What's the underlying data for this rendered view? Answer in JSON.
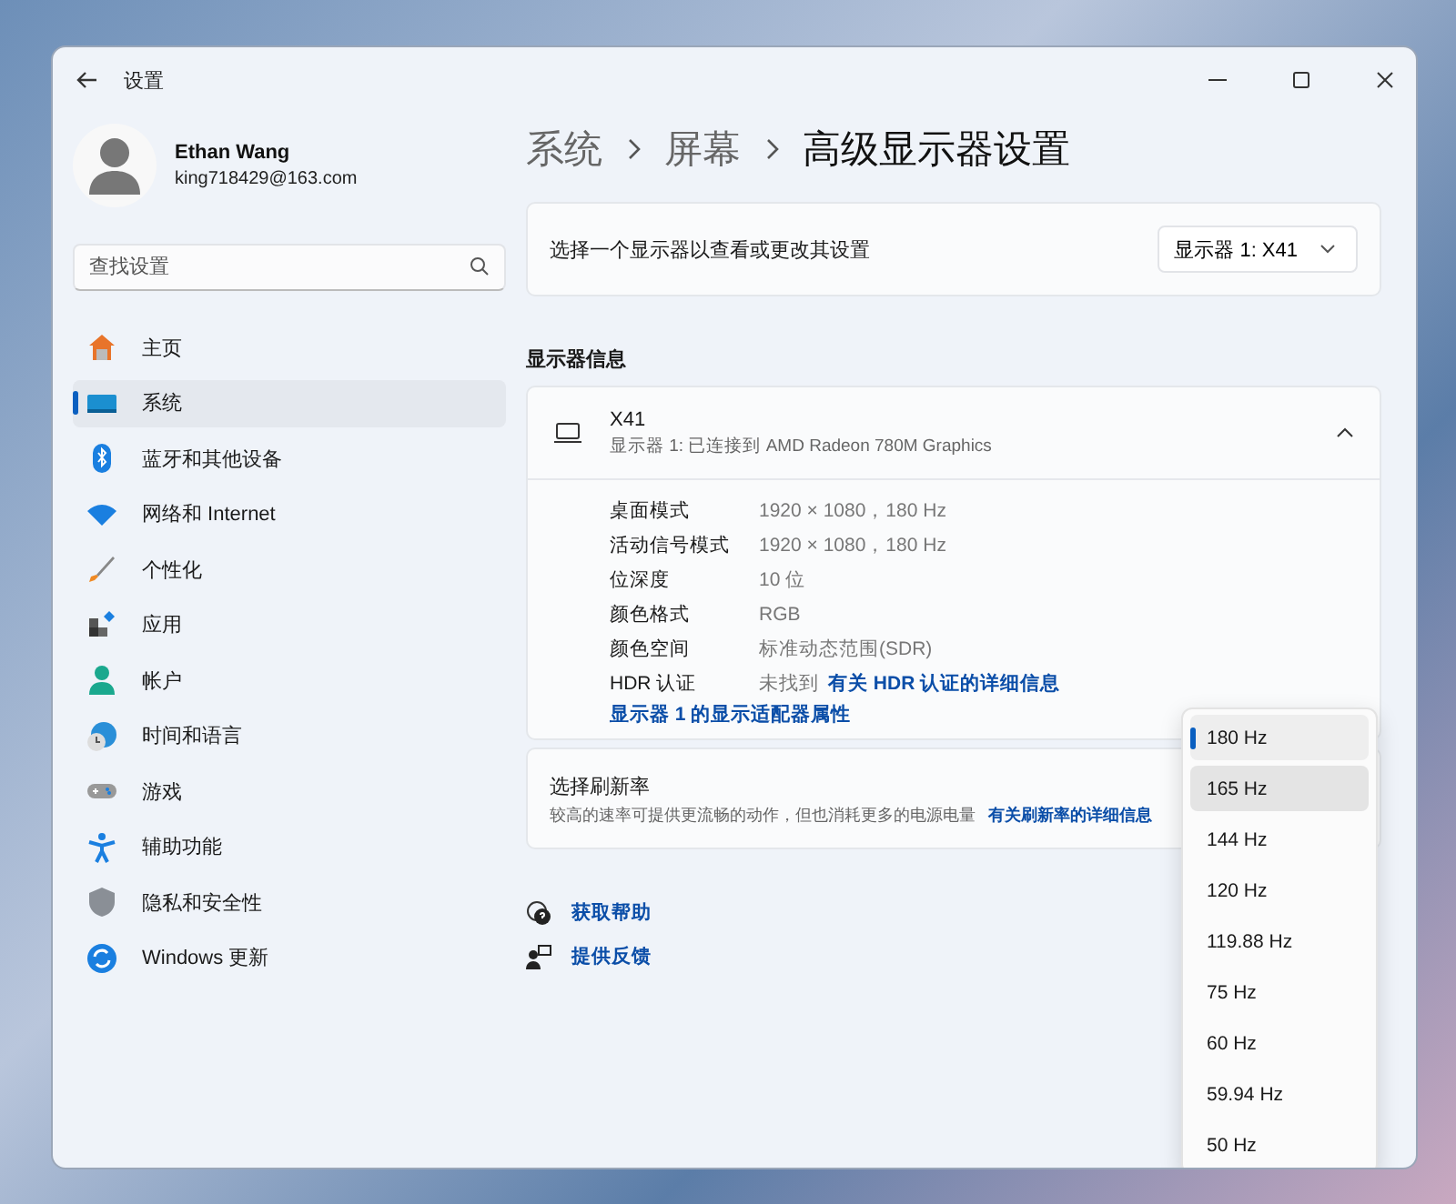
{
  "window": {
    "title": "设置"
  },
  "account": {
    "name": "Ethan Wang",
    "email": "king718429@163.com"
  },
  "search": {
    "placeholder": "查找设置"
  },
  "sidebar": {
    "items": [
      {
        "label": "主页",
        "selected": false
      },
      {
        "label": "系统",
        "selected": true
      },
      {
        "label": "蓝牙和其他设备",
        "selected": false
      },
      {
        "label": "网络和 Internet",
        "selected": false
      },
      {
        "label": "个性化",
        "selected": false
      },
      {
        "label": "应用",
        "selected": false
      },
      {
        "label": "帐户",
        "selected": false
      },
      {
        "label": "时间和语言",
        "selected": false
      },
      {
        "label": "游戏",
        "selected": false
      },
      {
        "label": "辅助功能",
        "selected": false
      },
      {
        "label": "隐私和安全性",
        "selected": false
      },
      {
        "label": "Windows 更新",
        "selected": false
      }
    ]
  },
  "breadcrumb": [
    "系统",
    "屏幕",
    "高级显示器设置"
  ],
  "display_select": {
    "label": "选择一个显示器以查看或更改其设置",
    "value": "显示器 1: X41"
  },
  "section_title": "显示器信息",
  "display_card": {
    "name": "X41",
    "subtitle": "显示器 1: 已连接到 AMD Radeon 780M Graphics",
    "expanded": true,
    "rows": [
      {
        "label": "桌面模式",
        "value": "1920 × 1080，180 Hz"
      },
      {
        "label": "活动信号模式",
        "value": "1920 × 1080，180 Hz"
      },
      {
        "label": "位深度",
        "value": "10 位"
      },
      {
        "label": "颜色格式",
        "value": "RGB"
      },
      {
        "label": "颜色空间",
        "value": "标准动态范围(SDR)"
      },
      {
        "label": "HDR 认证",
        "value": "未找到",
        "link": "有关 HDR 认证的详细信息"
      }
    ],
    "adapter_link": "显示器 1 的显示适配器属性"
  },
  "refresh_rate": {
    "title": "选择刷新率",
    "description": "较高的速率可提供更流畅的动作，但也消耗更多的电源电量",
    "link": "有关刷新率的详细信息",
    "options": [
      {
        "label": "180 Hz",
        "selected": true,
        "hovered": false
      },
      {
        "label": "165 Hz",
        "selected": false,
        "hovered": true
      },
      {
        "label": "144 Hz",
        "selected": false,
        "hovered": false
      },
      {
        "label": "120 Hz",
        "selected": false,
        "hovered": false
      },
      {
        "label": "119.88 Hz",
        "selected": false,
        "hovered": false
      },
      {
        "label": "75 Hz",
        "selected": false,
        "hovered": false
      },
      {
        "label": "60 Hz",
        "selected": false,
        "hovered": false
      },
      {
        "label": "59.94 Hz",
        "selected": false,
        "hovered": false
      },
      {
        "label": "50 Hz",
        "selected": false,
        "hovered": false
      }
    ]
  },
  "help_links": [
    "获取帮助",
    "提供反馈"
  ]
}
